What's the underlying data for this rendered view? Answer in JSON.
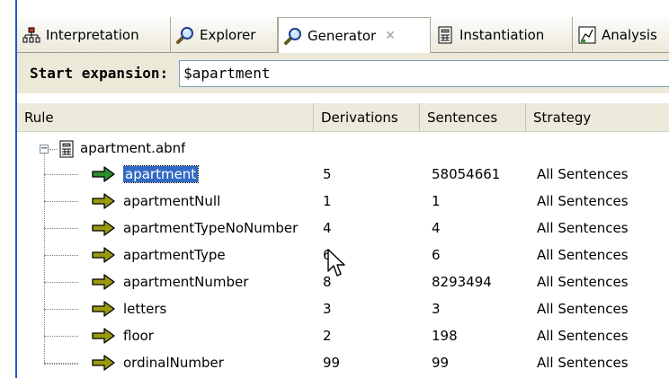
{
  "tabs": [
    {
      "label": "Interpretation",
      "icon": "hierarchy-icon"
    },
    {
      "label": "Explorer",
      "icon": "magnifier-icon"
    },
    {
      "label": "Generator",
      "icon": "magnifier-icon",
      "active": true,
      "close": "✕"
    },
    {
      "label": "Instantiation",
      "icon": "document-grid-icon"
    },
    {
      "label": "Analysis",
      "icon": "chart-icon"
    }
  ],
  "start_expansion": {
    "label": "Start expansion:",
    "value": "$apartment"
  },
  "table": {
    "columns": [
      "Rule",
      "Derivations",
      "Sentences",
      "Strategy"
    ],
    "root": {
      "label": "apartment.abnf",
      "toggle": "−"
    },
    "rows": [
      {
        "rule": "apartment",
        "derivations": "5",
        "sentences": "58054661",
        "strategy": "All Sentences",
        "selected": true
      },
      {
        "rule": "apartmentNull",
        "derivations": "1",
        "sentences": "1",
        "strategy": "All Sentences"
      },
      {
        "rule": "apartmentTypeNoNumber",
        "derivations": "4",
        "sentences": "4",
        "strategy": "All Sentences"
      },
      {
        "rule": "apartmentType",
        "derivations": "6",
        "sentences": "6",
        "strategy": "All Sentences"
      },
      {
        "rule": "apartmentNumber",
        "derivations": "8",
        "sentences": "8293494",
        "strategy": "All Sentences"
      },
      {
        "rule": "letters",
        "derivations": "3",
        "sentences": "3",
        "strategy": "All Sentences"
      },
      {
        "rule": "floor",
        "derivations": "2",
        "sentences": "198",
        "strategy": "All Sentences"
      },
      {
        "rule": "ordinalNumber",
        "derivations": "99",
        "sentences": "99",
        "strategy": "All Sentences"
      }
    ]
  },
  "colors": {
    "selection": "#316ac5",
    "rule_arrow_fill": "#9a9a10",
    "selected_arrow_fill": "#2e8b2e",
    "frame_border": "#1f57c7"
  }
}
